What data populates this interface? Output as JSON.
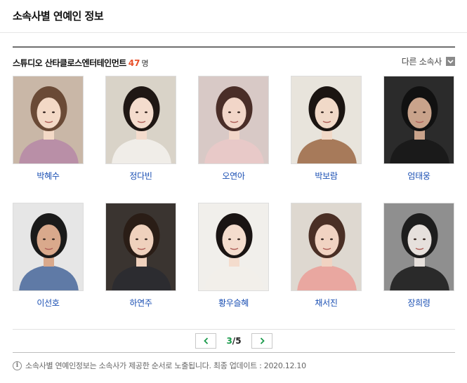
{
  "header": {
    "title": "소속사별 연예인 정보"
  },
  "agency": {
    "name": "스튜디오 산타클로스엔터테인먼트",
    "count": "47",
    "unit": "명"
  },
  "other_agency": {
    "label": "다른 소속사",
    "icon": "chevron-down-icon"
  },
  "celebrities": [
    {
      "name": "박혜수",
      "bg": "#c9b7a7",
      "hair": "#6a4a36",
      "skin": "#f3d9c6",
      "cloth": "#b98fa7"
    },
    {
      "name": "정다빈",
      "bg": "#d9d3c8",
      "hair": "#1f1714",
      "skin": "#f4dccd",
      "cloth": "#f0ede8"
    },
    {
      "name": "오연아",
      "bg": "#d8c9c6",
      "hair": "#4a2e28",
      "skin": "#f2d6c8",
      "cloth": "#e8c9c8"
    },
    {
      "name": "박보람",
      "bg": "#e8e4dc",
      "hair": "#1b1512",
      "skin": "#f1d9c8",
      "cloth": "#a77a5a"
    },
    {
      "name": "엄태웅",
      "bg": "#2b2b2b",
      "hair": "#111111",
      "skin": "#c9a38b",
      "cloth": "#1a1a1a"
    },
    {
      "name": "이선호",
      "bg": "#e6e6e6",
      "hair": "#1a1a1a",
      "skin": "#d9a98c",
      "cloth": "#5f7aa6"
    },
    {
      "name": "하연주",
      "bg": "#3a3430",
      "hair": "#2a1d16",
      "skin": "#efd1bd",
      "cloth": "#2c2c30"
    },
    {
      "name": "황우슬혜",
      "bg": "#f1efeb",
      "hair": "#1a1413",
      "skin": "#f4dccd",
      "cloth": "#f2efea"
    },
    {
      "name": "채서진",
      "bg": "#ded8d0",
      "hair": "#4a2f25",
      "skin": "#f1d3c2",
      "cloth": "#e9a7a0"
    },
    {
      "name": "장희령",
      "bg": "#8f8f8f",
      "hair": "#1d1d1d",
      "skin": "#e6e0dc",
      "cloth": "#2a2a2a"
    }
  ],
  "pager": {
    "current": "3",
    "total": "5",
    "separator": "/",
    "prev_icon": "chevron-left-icon",
    "next_icon": "chevron-right-icon"
  },
  "footer": {
    "icon": "info-icon",
    "icon_glyph": "i",
    "note": "소속사별 연예인정보는 소속사가 제공한 순서로 노출됩니다. 최종 업데이트 : 2020.12.10"
  },
  "colors": {
    "accent_count": "#e8502a",
    "name_link": "#1a4fb3",
    "pager_arrow": "#1a9a4b"
  }
}
